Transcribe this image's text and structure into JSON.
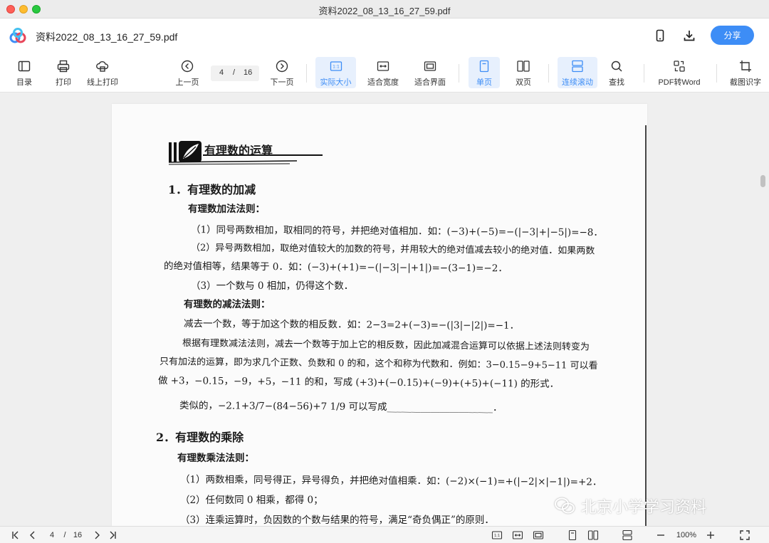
{
  "window": {
    "title": "资料2022_08_13_16_27_59.pdf"
  },
  "header": {
    "filename": "资料2022_08_13_16_27_59.pdf",
    "share_label": "分享"
  },
  "toolbar": {
    "contents": "目录",
    "print": "打印",
    "online_print": "线上打印",
    "prev_page": "上一页",
    "current_page": "4",
    "page_sep": "/",
    "total_pages": "16",
    "next_page": "下一页",
    "actual_size": "实际大小",
    "fit_width": "适合宽度",
    "fit_screen": "适合界面",
    "single_page": "单页",
    "double_page": "双页",
    "continuous_scroll": "连续滚动",
    "search": "查找",
    "pdf_to_word": "PDF转Word",
    "screenshot_ocr": "截图识字"
  },
  "document": {
    "title": "有理数的运算",
    "s1": "1．有理数的加减",
    "add_rule": "有理数加法法则：",
    "l1": "（1）同号两数相加，取相同的符号，并把绝对值相加．如：(−3)+(−5)=−(|−3|+|−5|)=−8．",
    "l2": "（2）异号两数相加，取绝对值较大的加数的符号，并用较大的绝对值减去较小的绝对值．如果两数",
    "l3": "的绝对值相等，结果等于 0．如：(−3)+(+1)=−(|−3|−|+1|)=−(3−1)=−2．",
    "l4": "（3）一个数与 0 相加，仍得这个数．",
    "sub_rule": "有理数的减法法则：",
    "l5": "减去一个数，等于加这个数的相反数．如：2−3=2+(−3)=−(|3|−|2|)=−1．",
    "l6": "根据有理数减法法则，减去一个数等于加上它的相反数，因此加减混合运算可以依据上述法则转变为",
    "l7": "只有加法的运算，即为求几个正数、负数和 0 的和，这个和称为代数和．例如：3−0.15−9+5−11 可以看",
    "l8": "做 +3，−0.15，−9，+5，−11 的和，写成 (+3)+(−0.15)+(−9)+(+5)+(−11) 的形式．",
    "l9": "类似的，−2.1+3/7−(84−56)+7 1/9 可以写成______________________．",
    "s2": "2．有理数的乘除",
    "mul_rule": "有理数乘法法则：",
    "l10": "（1）两数相乘，同号得正，异号得负，并把绝对值相乘．如：(−2)×(−1)=+(|−2|×|−1|)=+2．",
    "l11": "（2）任何数同 0 相乘，都得 0；",
    "l12": "（3）连乘运算时，负因数的个数与结果的符号，满足“奇负偶正”的原则．"
  },
  "watermark": "北京小学学习资料",
  "statusbar": {
    "current_page": "4",
    "page_sep": "/",
    "total_pages": "16",
    "zoom": "100%"
  }
}
